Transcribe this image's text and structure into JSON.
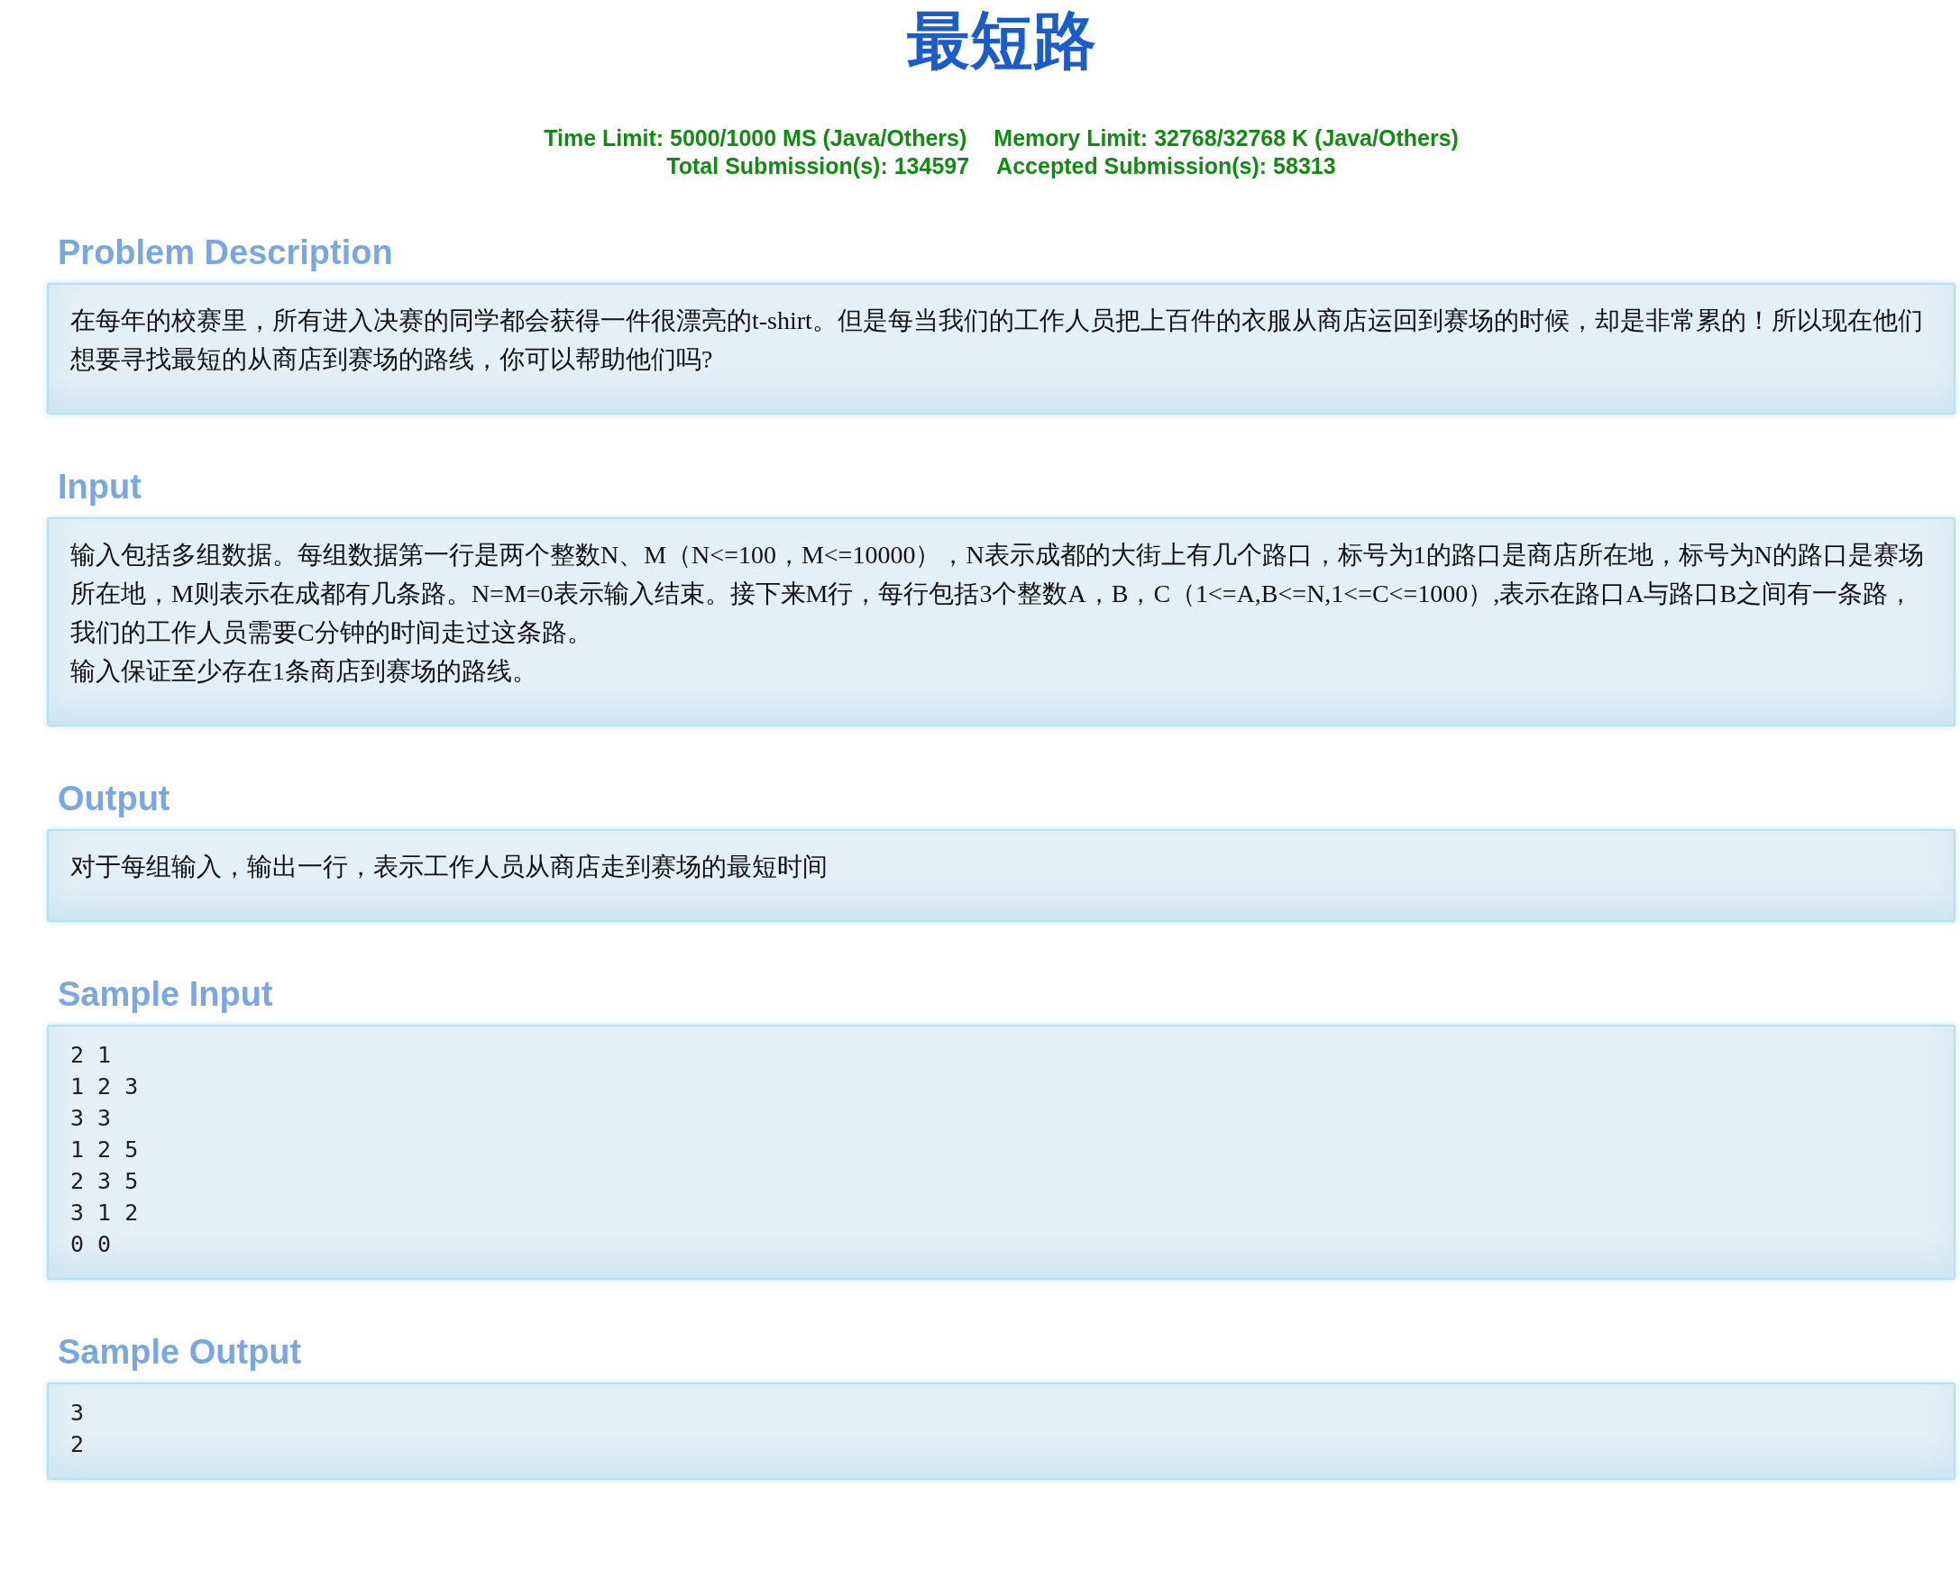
{
  "title": "最短路",
  "limits": [
    [
      "Time Limit: 5000/1000 MS (Java/Others)",
      "Memory Limit: 32768/32768 K (Java/Others)"
    ],
    [
      "Total Submission(s): 134597",
      "Accepted Submission(s): 58313"
    ]
  ],
  "sections": [
    {
      "heading": "Problem Description",
      "kind": "text",
      "paragraphs": [
        "在每年的校赛里，所有进入决赛的同学都会获得一件很漂亮的t-shirt。但是每当我们的工作人员把上百件的衣服从商店运回到赛场的时候，却是非常累的！所以现在他们想要寻找最短的从商店到赛场的路线，你可以帮助他们吗?"
      ]
    },
    {
      "heading": "Input",
      "kind": "text",
      "paragraphs": [
        "输入包括多组数据。每组数据第一行是两个整数N、M（N<=100，M<=10000），N表示成都的大街上有几个路口，标号为1的路口是商店所在地，标号为N的路口是赛场所在地，M则表示在成都有几条路。N=M=0表示输入结束。接下来M行，每行包括3个整数A，B，C（1<=A,B<=N,1<=C<=1000）,表示在路口A与路口B之间有一条路，我们的工作人员需要C分钟的时间走过这条路。",
        "输入保证至少存在1条商店到赛场的路线。"
      ]
    },
    {
      "heading": "Output",
      "kind": "text",
      "paragraphs": [
        "对于每组输入，输出一行，表示工作人员从商店走到赛场的最短时间"
      ]
    },
    {
      "heading": "Sample Input",
      "kind": "code",
      "lines": [
        "2 1",
        "1 2 3",
        "3 3",
        "1 2 5",
        "2 3 5",
        "3 1 2",
        "0 0"
      ]
    },
    {
      "heading": "Sample Output",
      "kind": "code",
      "lines": [
        "3",
        "2"
      ]
    }
  ]
}
